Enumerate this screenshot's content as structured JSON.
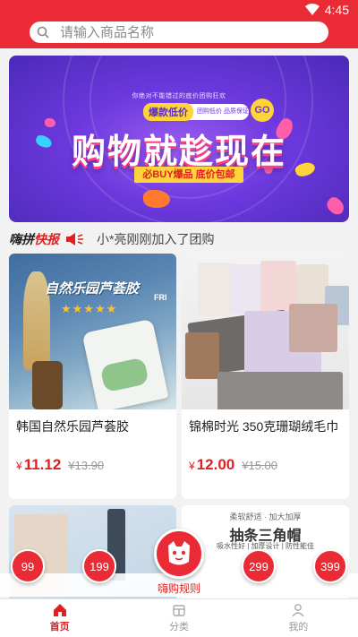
{
  "status_bar": {
    "time": "4:45",
    "wifi_icon": "wifi-icon"
  },
  "search": {
    "placeholder": "请输入商品名称",
    "icon": "search-icon"
  },
  "banner": {
    "subtitle": "你绝对不能错过的底价团购狂欢",
    "pill_left": "爆款低价",
    "pill_right": "团购低价 品质保证",
    "go": "GO",
    "headline": "购物就趁现在",
    "tagline": "必BUY爆品 底价包邮"
  },
  "notice": {
    "brand_black": "嗨拼",
    "brand_red": "快报",
    "message": "小*亮刚刚加入了团购"
  },
  "products": [
    {
      "title": "韩国自然乐园芦荟胶",
      "image_text": "自然乐园芦荟胶",
      "image_tag": "FRI",
      "stars": "★★★★★",
      "currency": "¥",
      "price": "11.12",
      "old_price": "¥13.90"
    },
    {
      "title": "锦棉时光 350克珊瑚绒毛巾",
      "currency": "¥",
      "price": "12.00",
      "old_price": "¥15.00"
    },
    {
      "title": "",
      "image_text": ""
    },
    {
      "title": "",
      "image_text_top": "柔软舒适 · 加大加厚",
      "image_text_main": "抽条三角帽",
      "image_text_bottom": "吸水性好 | 加厚设计 | 防性能佳"
    }
  ],
  "float_buttons": [
    "99",
    "199",
    "299",
    "399"
  ],
  "center_button": {
    "label": "嗨购规则",
    "icon": "mascot-icon"
  },
  "nav": [
    {
      "label": "首页",
      "icon": "home-icon",
      "active": true
    },
    {
      "label": "分类",
      "icon": "category-icon",
      "active": false
    },
    {
      "label": "我的",
      "icon": "user-icon",
      "active": false
    }
  ],
  "colors": {
    "brand": "#ea2b36",
    "price": "#e02020",
    "banner": "#6c38dd"
  }
}
